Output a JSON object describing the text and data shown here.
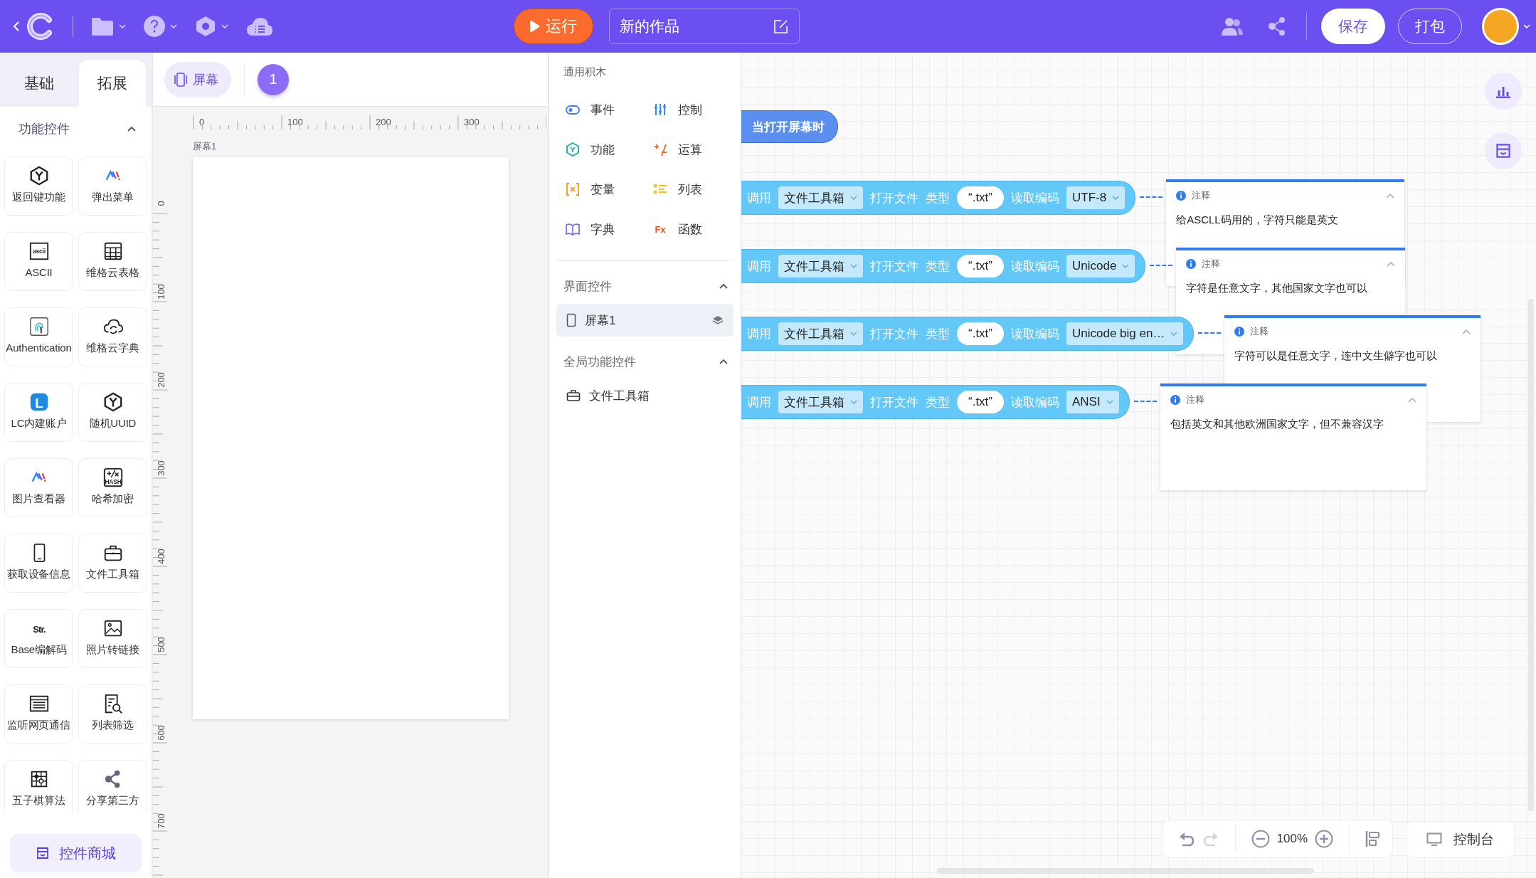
{
  "topbar": {
    "run_button": "运行",
    "title_field": "新的作品",
    "save_button": "保存",
    "pack_button": "打包"
  },
  "sidebar": {
    "tabs": [
      {
        "label": "基础",
        "selected": false
      },
      {
        "label": "拓展",
        "selected": true
      }
    ],
    "section": {
      "title": "功能控件",
      "expanded": true
    },
    "items": [
      {
        "label": "返回键功能"
      },
      {
        "label": "弹出菜单"
      },
      {
        "label": "ASCII",
        "icon_text": "ascii"
      },
      {
        "label": "维格云表格"
      },
      {
        "label": "Authentication"
      },
      {
        "label": "维格云字典"
      },
      {
        "label": "LC内建账户",
        "icon_text": "L"
      },
      {
        "label": "随机UUID"
      },
      {
        "label": "图片查看器"
      },
      {
        "label": "哈希加密"
      },
      {
        "label": "获取设备信息"
      },
      {
        "label": "文件工具箱"
      },
      {
        "label": "Base编解码",
        "icon_text": "Str."
      },
      {
        "label": "照片转链接"
      },
      {
        "label": "监听网页通信"
      },
      {
        "label": "列表筛选"
      },
      {
        "label": "五子棋算法"
      },
      {
        "label": "分享第三方"
      }
    ],
    "hash_icon_text": "HASH",
    "store_button": "控件商城"
  },
  "stage": {
    "screen_button": "屏幕",
    "page_badge": "1",
    "x_ruler": [
      "0",
      "100",
      "200",
      "300"
    ],
    "y_ruler": [
      "0",
      "100",
      "200",
      "300",
      "400",
      "500",
      "600",
      "700"
    ],
    "screen_label": "屏幕1"
  },
  "blocks_panel": {
    "title": "通用积木",
    "categories": [
      {
        "label": "事件",
        "color": "#4a7cf5"
      },
      {
        "label": "控制",
        "color": "#2f8ff0"
      },
      {
        "label": "功能",
        "color": "#1fb5a8"
      },
      {
        "label": "运算",
        "color": "#f26b2e"
      },
      {
        "label": "变量",
        "color": "#f59a23"
      },
      {
        "label": "列表",
        "color": "#f5be1f"
      },
      {
        "label": "字典",
        "color": "#7d6cf0"
      },
      {
        "label": "函数",
        "color": "#f5512b",
        "icon_text": "Fx"
      }
    ],
    "sections": [
      {
        "title": "界面控件",
        "expanded": true,
        "items": [
          {
            "label": "屏幕1",
            "selected": true
          }
        ]
      },
      {
        "title": "全局功能控件",
        "expanded": true,
        "items": [
          {
            "label": "文件工具箱",
            "selected": false
          }
        ]
      }
    ]
  },
  "workspace": {
    "hat_block": "当打开屏幕时",
    "blocks": [
      {
        "call": "调用",
        "component": "文件工具箱",
        "method": "打开文件",
        "type_label": "类型",
        "type_value": "“.txt”",
        "encoding_label": "读取编码",
        "encoding": "UTF-8",
        "comment": {
          "title": "注释",
          "text": "给ASCLL码用的，字符只能是英文"
        }
      },
      {
        "call": "调用",
        "component": "文件工具箱",
        "method": "打开文件",
        "type_label": "类型",
        "type_value": "“.txt”",
        "encoding_label": "读取编码",
        "encoding": "Unicode",
        "comment": {
          "title": "注释",
          "text": "字符是任意文字，其他国家文字也可以"
        }
      },
      {
        "call": "调用",
        "component": "文件工具箱",
        "method": "打开文件",
        "type_label": "类型",
        "type_value": "“.txt”",
        "encoding_label": "读取编码",
        "encoding": "Unicode big en…",
        "comment": {
          "title": "注释",
          "text": "字符可以是任意文字，连中文生僻字也可以"
        }
      },
      {
        "call": "调用",
        "component": "文件工具箱",
        "method": "打开文件",
        "type_label": "类型",
        "type_value": "“.txt”",
        "encoding_label": "读取编码",
        "encoding": "ANSI",
        "comment": {
          "title": "注释",
          "text": "包括英文和其他欧洲国家文字，但不兼容汉字"
        }
      }
    ],
    "toolbar": {
      "undo": {
        "disabled": false
      },
      "redo": {
        "disabled": true
      },
      "zoom": "100%"
    },
    "console_button": "控制台"
  }
}
